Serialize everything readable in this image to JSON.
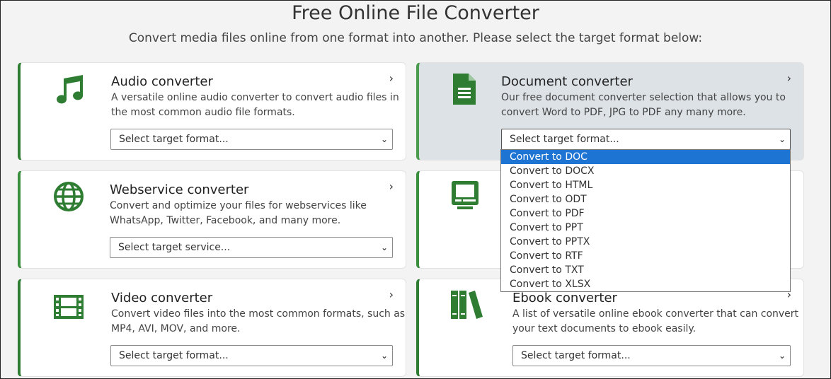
{
  "header": {
    "title": "Free Online File Converter",
    "subtitle": "Convert media files online from one format into another. Please select the target format below:"
  },
  "cards": {
    "audio": {
      "title": "Audio converter",
      "desc_line1": "A versatile online audio converter to convert audio files in",
      "desc_line2": "the most common audio file formats.",
      "select": "Select target format...",
      "icon": "music-note-icon"
    },
    "document": {
      "title": "Document converter",
      "desc_line1": "Our free document converter selection that allows you to",
      "desc_line2": "convert Word to PDF, JPG to PDF any many more.",
      "select": "Select target format...",
      "icon": "document-icon"
    },
    "webservice": {
      "title": "Webservice converter",
      "desc_line1": "Convert and optimize your files for webservices like",
      "desc_line2": "WhatsApp, Twitter, Facebook, and many more.",
      "select": "Select target service...",
      "icon": "globe-icon"
    },
    "device": {
      "icon": "monitor-icon"
    },
    "video": {
      "title": "Video converter",
      "desc_line1": "Convert video files into the most common formats, such as",
      "desc_line2": "MP4, AVI, MOV, and more.",
      "select": "Select target format...",
      "icon": "film-icon"
    },
    "ebook": {
      "title": "Ebook converter",
      "desc_line1": "A list of versatile online ebook converter that can convert",
      "desc_line2": "your text documents to ebook easily.",
      "select": "Select target format...",
      "icon": "books-icon"
    }
  },
  "chevron": "›",
  "caret": "⌄",
  "dropdown": {
    "options": [
      "Convert to DOC",
      "Convert to DOCX",
      "Convert to HTML",
      "Convert to ODT",
      "Convert to PDF",
      "Convert to PPT",
      "Convert to PPTX",
      "Convert to RTF",
      "Convert to TXT",
      "Convert to XLSX"
    ],
    "selected_index": 0
  },
  "colors": {
    "accent_green": "#2e7d32",
    "highlight_blue": "#1e74d3",
    "active_card_bg": "#dde2e6"
  }
}
